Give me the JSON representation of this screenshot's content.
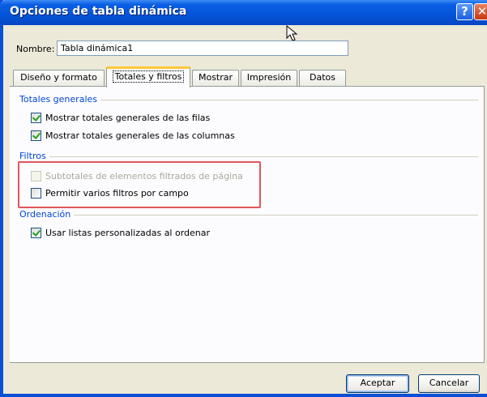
{
  "window": {
    "title": "Opciones de tabla dinámica",
    "help_glyph": "?",
    "close_glyph": "✕"
  },
  "name_field": {
    "label": "Nombre:",
    "value": "Tabla dinámica1"
  },
  "tabs": [
    {
      "label": "Diseño y formato",
      "active": false
    },
    {
      "label": "Totales y filtros",
      "active": true
    },
    {
      "label": "Mostrar",
      "active": false
    },
    {
      "label": "Impresión",
      "active": false
    },
    {
      "label": "Datos",
      "active": false
    }
  ],
  "sections": {
    "totales": {
      "header": "Totales generales",
      "items": [
        {
          "label": "Mostrar totales generales de las filas",
          "checked": true,
          "disabled": false
        },
        {
          "label": "Mostrar totales generales de las columnas",
          "checked": true,
          "disabled": false
        }
      ]
    },
    "filtros": {
      "header": "Filtros",
      "items": [
        {
          "label": "Subtotales de elementos filtrados de página",
          "checked": false,
          "disabled": true
        },
        {
          "label": "Permitir varios filtros por campo",
          "checked": false,
          "disabled": false
        }
      ]
    },
    "ordenacion": {
      "header": "Ordenación",
      "items": [
        {
          "label": "Usar listas personalizadas al ordenar",
          "checked": true,
          "disabled": false
        }
      ]
    }
  },
  "buttons": {
    "accept": "Aceptar",
    "cancel": "Cancelar"
  },
  "colors": {
    "title_bar": "#0453d8",
    "section_header": "#0046d5",
    "highlight_box": "#e0555e",
    "active_tab_accent": "#ffc83c"
  }
}
